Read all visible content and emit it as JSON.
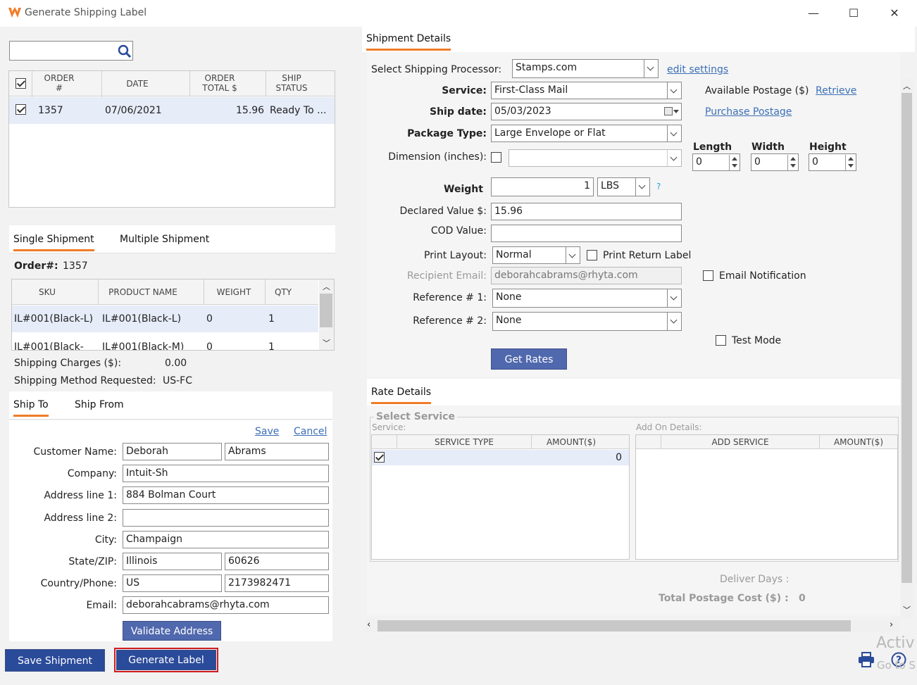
{
  "window": {
    "title": "Generate Shipping Label",
    "minimize": "—",
    "maximize": "☐",
    "close": "✕"
  },
  "orders": {
    "search_value": "",
    "columns": [
      "ORDER #",
      "DATE",
      "ORDER TOTAL $",
      "SHIP STATUS"
    ],
    "col_order": "ORDER",
    "col_order2": "#",
    "col_date": "DATE",
    "col_total": "ORDER",
    "col_total2": "TOTAL $",
    "col_status": "SHIP",
    "col_status2": "STATUS",
    "rows": [
      {
        "order": "1357",
        "date": "07/06/2021",
        "total": "15.96",
        "status": "Ready To ..."
      }
    ]
  },
  "shipment_tabs": {
    "single": "Single Shipment",
    "multiple": "Multiple Shipment"
  },
  "order_info": {
    "label": "Order#:",
    "value": "1357"
  },
  "items": {
    "columns": {
      "sku": "SKU",
      "name": "PRODUCT NAME",
      "weight": "WEIGHT",
      "qty": "QTY"
    },
    "rows": [
      {
        "sku": "IL#001(Black-L)",
        "name": "IL#001(Black-L)",
        "weight": "0",
        "qty": "1"
      },
      {
        "sku": "IL#001(Black-",
        "name": "IL#001(Black-M)",
        "weight": "0",
        "qty": "1"
      }
    ]
  },
  "charges": {
    "shipping_label": "Shipping Charges ($):",
    "shipping_value": "0.00",
    "method_label": "Shipping Method Requested:",
    "method_value": "US-FC"
  },
  "address_tabs": {
    "ship_to": "Ship To",
    "ship_from": "Ship From"
  },
  "address": {
    "save": "Save",
    "cancel": "Cancel",
    "customer_label": "Customer Name:",
    "first_name": "Deborah",
    "last_name": "Abrams",
    "company_label": "Company:",
    "company": "Intuit-Sh",
    "addr1_label": "Address line 1:",
    "addr1": "884 Bolman Court",
    "addr2_label": "Address line 2:",
    "addr2": "",
    "city_label": "City:",
    "city": "Champaign",
    "state_label": "State/ZIP:",
    "state": "Illinois",
    "zip": "60626",
    "country_label": "Country/Phone:",
    "country": "US",
    "phone": "2173982471",
    "email_label": "Email:",
    "email": "deborahcabrams@rhyta.com",
    "validate": "Validate Address"
  },
  "actions": {
    "save_shipment": "Save Shipment",
    "generate_label": "Generate Label"
  },
  "shipment_details": {
    "tab": "Shipment Details",
    "processor_label": "Select Shipping Processor:",
    "processor": "Stamps.com",
    "edit_settings": "edit settings",
    "service_label": "Service:",
    "service": "First-Class Mail",
    "available_postage_label": "Available Postage ($)",
    "retrieve": "Retrieve",
    "shipdate_label": "Ship date:",
    "shipdate": "05/03/2023",
    "purchase_postage": "Purchase Postage",
    "package_label": "Package Type:",
    "package": "Large Envelope or Flat",
    "dimension_label": "Dimension (inches):",
    "dimension": "",
    "length_label": "Length",
    "length": "0",
    "width_label": "Width",
    "width": "0",
    "height_label": "Height",
    "height": "0",
    "weight_label": "Weight",
    "weight": "1",
    "weight_unit": "LBS",
    "help": "?",
    "declared_label": "Declared Value $:",
    "declared": "15.96",
    "cod_label": "COD Value:",
    "cod": "",
    "layout_label": "Print Layout:",
    "layout": "Normal",
    "print_return": "Print Return Label",
    "recipient_label": "Recipient Email:",
    "recipient": "deborahcabrams@rhyta.com",
    "email_notification": "Email Notification",
    "ref1_label": "Reference # 1:",
    "ref1": "None",
    "ref2_label": "Reference # 2:",
    "ref2": "None",
    "test_mode": "Test Mode",
    "get_rates": "Get Rates"
  },
  "rate_details": {
    "tab": "Rate Details",
    "legend": "Select Service",
    "service_label": "Service:",
    "addon_label": "Add On Details:",
    "col_service_type": "SERVICE TYPE",
    "col_amount": "AMOUNT($)",
    "col_add_service": "ADD SERVICE",
    "col_addon_amount": "AMOUNT($)",
    "amount_value": "0",
    "deliver_days_label": "Deliver Days :",
    "total_label": "Total Postage Cost ($) :",
    "total_value": "0"
  },
  "watermark": {
    "line1": "Activ",
    "line2": "Go to S"
  },
  "colors": {
    "accent": "#f07c28",
    "button": "#5068ad",
    "link": "#3b6fb6"
  }
}
